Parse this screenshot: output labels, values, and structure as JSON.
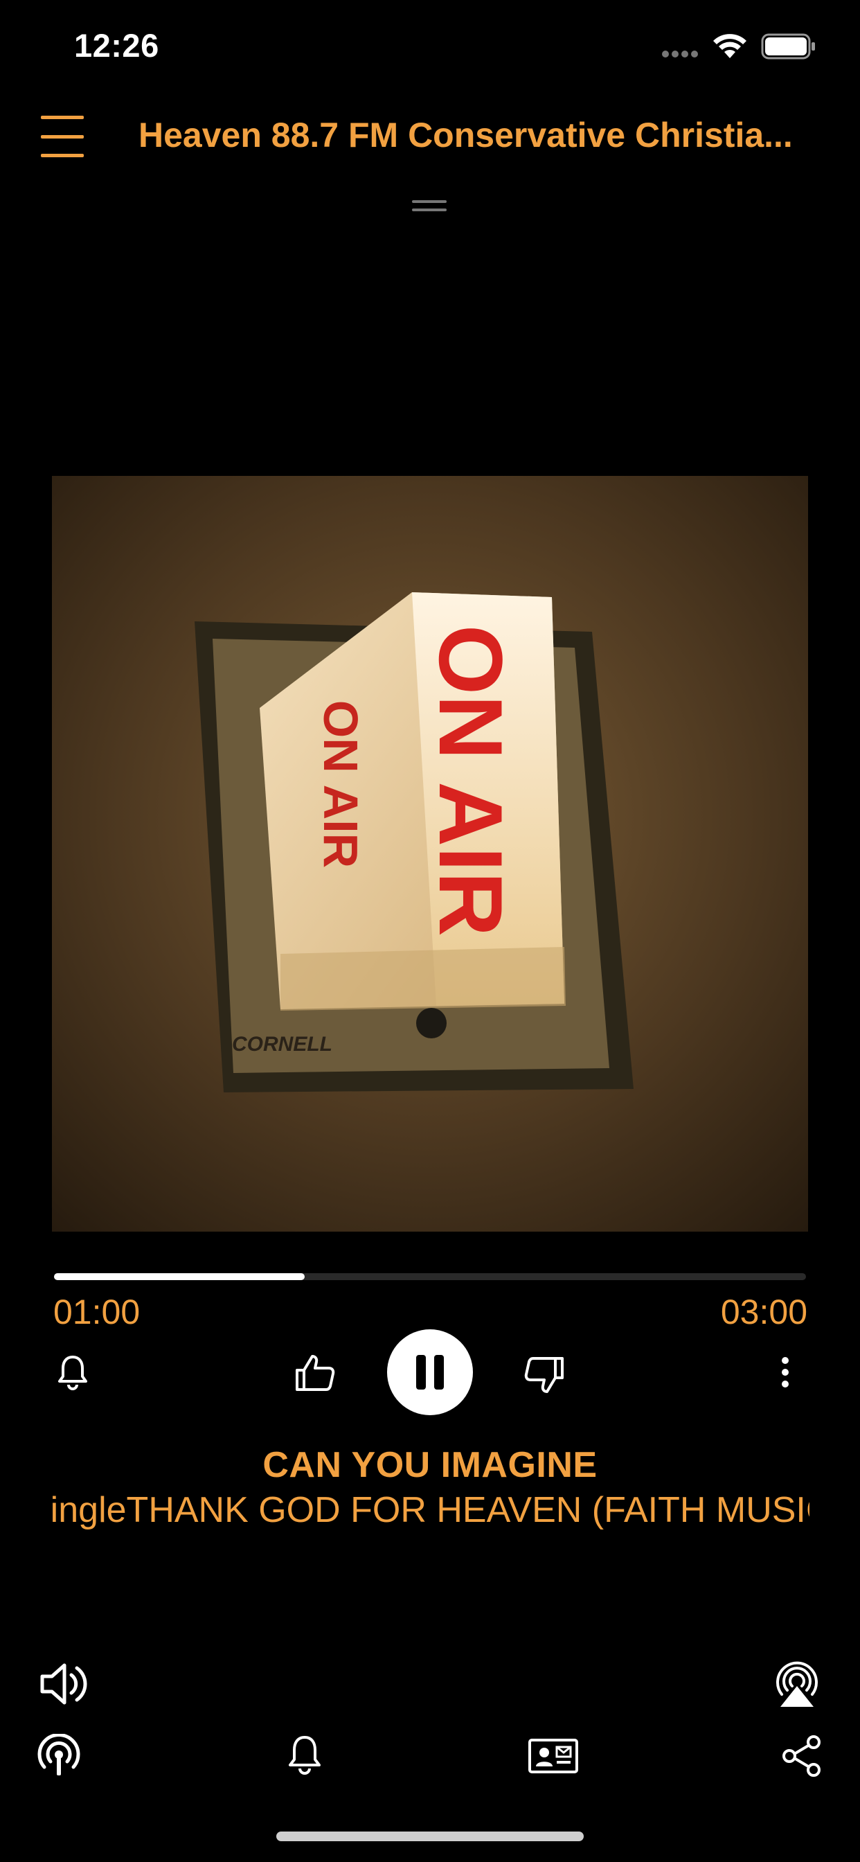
{
  "status_bar": {
    "time": "12:26",
    "signal_icon": "signal-dots-icon",
    "wifi_icon": "wifi-icon",
    "battery_icon": "battery-icon"
  },
  "header": {
    "menu_icon": "hamburger-menu-icon",
    "title": "Heaven 88.7 FM Conservative Christia...",
    "grabber_icon": "drag-handle-icon"
  },
  "artwork": {
    "caption": "ON AIR",
    "plate_text": "CORNELL"
  },
  "player": {
    "progress": 0.333,
    "elapsed": "01:00",
    "duration": "03:00",
    "controls": [
      "bell-icon",
      "thumbs-up-icon",
      "pause-icon",
      "thumbs-down-icon",
      "more-vertical-icon"
    ]
  },
  "now_playing": {
    "song_title": "CAN YOU IMAGINE",
    "subtitle": "SingleTHANK GOD FOR HEAVEN (FAITH MUSIC"
  },
  "bottom_bar": {
    "row1": [
      "volume-icon",
      "airplay-icon"
    ],
    "row2": [
      "podcast-broadcast-icon",
      "bell-icon",
      "contact-card-icon",
      "share-icon"
    ]
  },
  "colors": {
    "accent": "#F2A141",
    "background": "#000000",
    "foreground": "#FFFFFF"
  }
}
